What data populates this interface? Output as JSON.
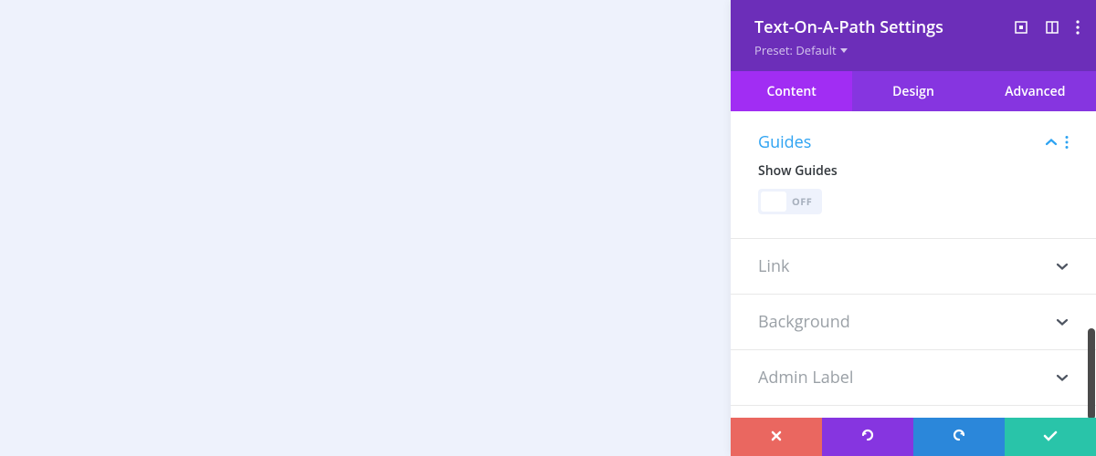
{
  "header": {
    "title": "Text-On-A-Path Settings",
    "preset_prefix": "Preset:",
    "preset_value": "Default"
  },
  "tabs": [
    {
      "label": "Content",
      "active": true
    },
    {
      "label": "Design",
      "active": false
    },
    {
      "label": "Advanced",
      "active": false
    }
  ],
  "sections": {
    "guides": {
      "title": "Guides",
      "expanded": true,
      "fields": {
        "show_guides": {
          "label": "Show Guides",
          "state": "OFF"
        }
      }
    },
    "link": {
      "title": "Link",
      "expanded": false
    },
    "background": {
      "title": "Background",
      "expanded": false
    },
    "admin_label": {
      "title": "Admin Label",
      "expanded": false
    }
  }
}
